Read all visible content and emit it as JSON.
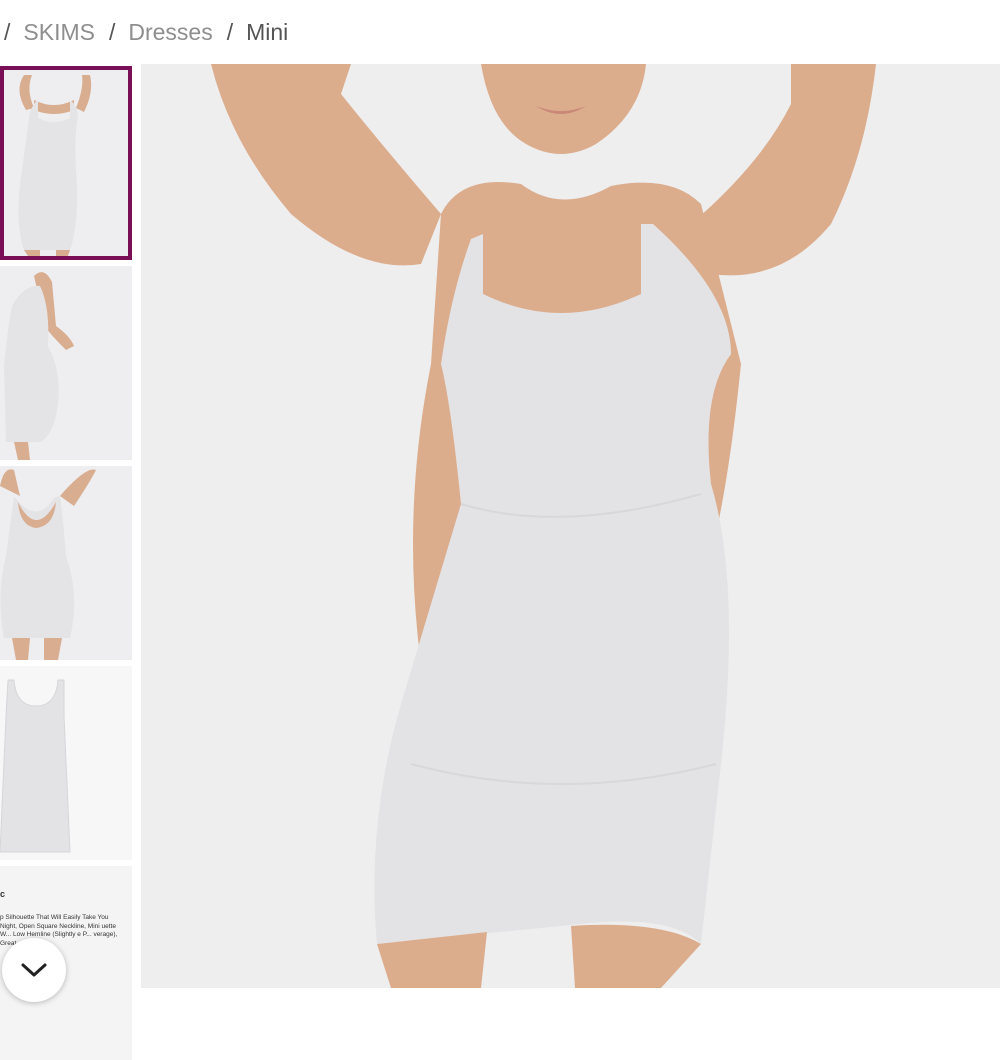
{
  "breadcrumb": {
    "items": [
      {
        "label": "SKIMS"
      },
      {
        "label": "Dresses"
      },
      {
        "label": "Mini"
      }
    ],
    "separator": "/"
  },
  "gallery": {
    "thumbnails": [
      {
        "view": "front",
        "selected": true
      },
      {
        "view": "side-back",
        "selected": false
      },
      {
        "view": "back",
        "selected": false
      },
      {
        "view": "flat-lay",
        "selected": false
      },
      {
        "view": "size-chart",
        "selected": false
      }
    ],
    "size_chart_thumb": {
      "heading": "c",
      "description": "p Silhouette That Will Easily Take You Night, Open Square Neckline, Mini uette W... Low Hemline (Slightly e P... verage), Great ... l Sets"
    },
    "scroll_down_icon": "chevron-down-icon",
    "selected_border_color": "#7a0f57"
  },
  "main_image": {
    "subject": "model wearing light grey square-neck mini dress",
    "dress_color": "#e3e3e6",
    "background_color": "#eeeeef"
  }
}
